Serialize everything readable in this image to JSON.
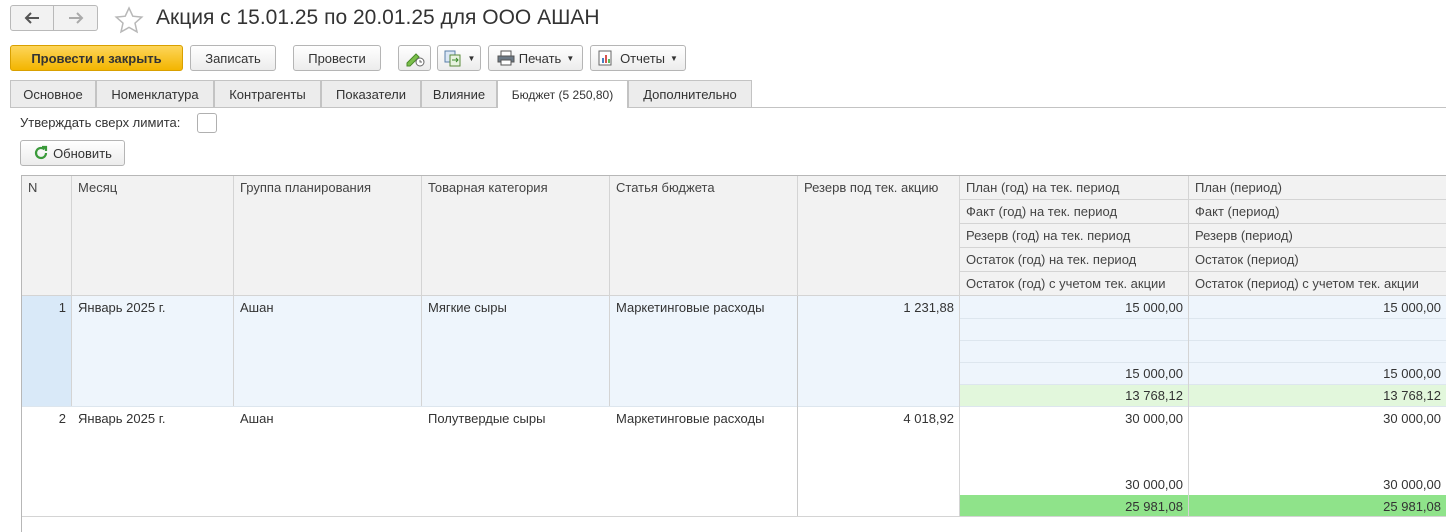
{
  "header": {
    "title": "Акция с 15.01.25 по 20.01.25 для ООО АШАН"
  },
  "toolbar": {
    "post_close": "Провести и закрыть",
    "save": "Записать",
    "post": "Провести",
    "print": "Печать",
    "reports": "Отчеты"
  },
  "tabs": [
    {
      "label": "Основное"
    },
    {
      "label": "Номенклатура"
    },
    {
      "label": "Контрагенты"
    },
    {
      "label": "Показатели"
    },
    {
      "label": "Влияние"
    },
    {
      "label": "Бюджет (5 250,80)"
    },
    {
      "label": "Дополнительно"
    }
  ],
  "form": {
    "approve_label": "Утверждать сверх лимита:",
    "approve_checked": false,
    "refresh": "Обновить"
  },
  "table": {
    "headers": {
      "n": "N",
      "month": "Месяц",
      "group": "Группа планирования",
      "category": "Товарная категория",
      "article": "Статья бюджета",
      "reserve": "Резерв под тек. акцию",
      "year_plan": "План (год) на тек. период",
      "year_fact": "Факт (год)  на тек. период",
      "year_reserve": "Резерв (год) на тек. период",
      "year_rest": "Остаток (год) на тек. период",
      "year_rest_action": "Остаток (год) с учетом тек. акции",
      "period_plan": "План (период)",
      "period_fact": "Факт (период)",
      "period_reserve": "Резерв (период)",
      "period_rest": "Остаток (период)",
      "period_rest_action": "Остаток (период) с учетом тек. акции"
    },
    "rows": [
      {
        "n": "1",
        "month": "Январь 2025 г.",
        "group": "Ашан",
        "category": "Мягкие сыры",
        "article": "Маркетинговые расходы",
        "reserve": "1 231,88",
        "year_plan": "15 000,00",
        "year_fact": "",
        "year_reserve": "",
        "year_rest": "15 000,00",
        "year_rest_action": "13 768,12",
        "period_plan": "15 000,00",
        "period_fact": "",
        "period_reserve": "",
        "period_rest": "15 000,00",
        "period_rest_action": "13 768,12"
      },
      {
        "n": "2",
        "month": "Январь 2025 г.",
        "group": "Ашан",
        "category": "Полутвердые сыры",
        "article": "Маркетинговые расходы",
        "reserve": "4 018,92",
        "year_plan": "30 000,00",
        "year_fact": "",
        "year_reserve": "",
        "year_rest": "30 000,00",
        "year_rest_action": "25 981,08",
        "period_plan": "30 000,00",
        "period_fact": "",
        "period_reserve": "",
        "period_rest": "30 000,00",
        "period_rest_action": "25 981,08"
      }
    ]
  },
  "colors": {
    "primary_button": "#f3b500",
    "selected_row": "#eef5fc",
    "rest_light_green": "#e2f7dc",
    "rest_green": "#8fe38a"
  }
}
